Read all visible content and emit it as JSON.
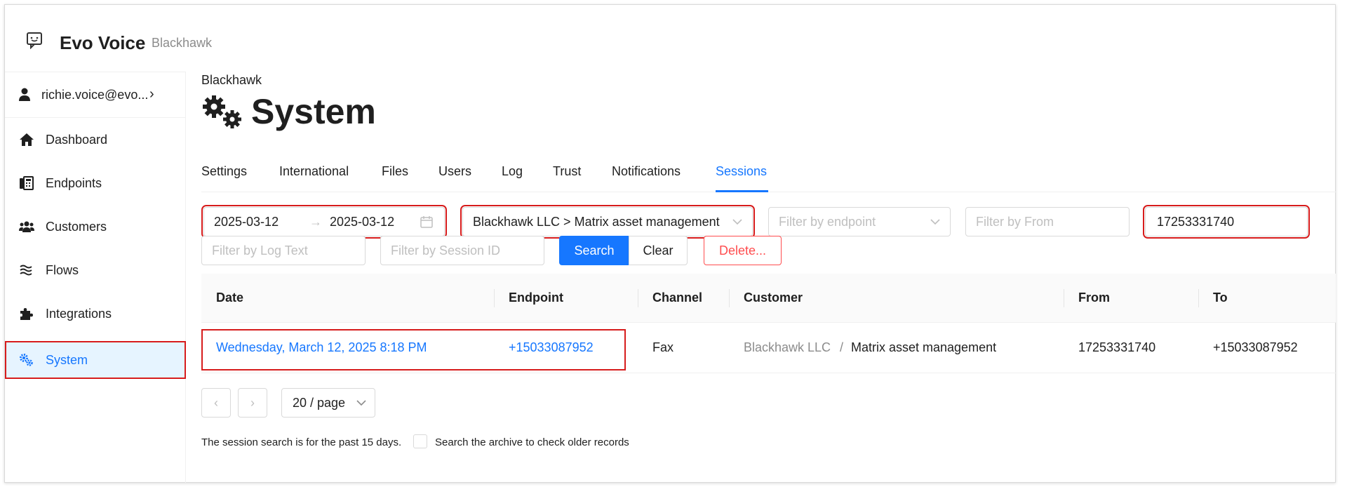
{
  "app": {
    "title": "Evo Voice",
    "subtitle": "Blackhawk",
    "logo_icon": "chat-bubble-icon"
  },
  "sidebar": {
    "user": {
      "label": "richie.voice@evo...",
      "icon": "user-icon",
      "chevron": "›"
    },
    "items": [
      {
        "label": "Dashboard",
        "icon": "home-icon"
      },
      {
        "label": "Endpoints",
        "icon": "phone-endpoints-icon"
      },
      {
        "label": "Customers",
        "icon": "users-icon"
      },
      {
        "label": "Flows",
        "icon": "flows-icon"
      },
      {
        "label": "Integrations",
        "icon": "puzzle-icon"
      },
      {
        "label": "System",
        "icon": "gears-icon",
        "active": true
      }
    ]
  },
  "page": {
    "breadcrumb": "Blackhawk",
    "title": "System",
    "title_icon": "gears-icon"
  },
  "tabs": [
    {
      "label": "Settings"
    },
    {
      "label": "International"
    },
    {
      "label": "Files"
    },
    {
      "label": "Users"
    },
    {
      "label": "Log"
    },
    {
      "label": "Trust"
    },
    {
      "label": "Notifications"
    },
    {
      "label": "Sessions",
      "active": true
    }
  ],
  "filters": {
    "date_start": "2025-03-12",
    "date_arrow": "→",
    "date_end": "2025-03-12",
    "customer_value": "Blackhawk LLC > Matrix asset management",
    "endpoint_placeholder": "Filter by endpoint",
    "from_placeholder": "Filter by From",
    "to_value": "17253331740",
    "log_text_placeholder": "Filter by Log Text",
    "session_id_placeholder": "Filter by Session ID",
    "search_label": "Search",
    "clear_label": "Clear",
    "delete_label": "Delete..."
  },
  "table": {
    "headers": [
      "Date",
      "Endpoint",
      "Channel",
      "Customer",
      "From",
      "To"
    ],
    "rows": [
      {
        "date": "Wednesday, March 12, 2025 8:18 PM",
        "endpoint": "+15033087952",
        "channel": "Fax",
        "customer_parent": "Blackhawk LLC",
        "customer_sep": "/",
        "customer_child": "Matrix asset management",
        "from": "17253331740",
        "to": "+15033087952"
      }
    ]
  },
  "pagination": {
    "prev": "‹",
    "next": "›",
    "page_size": "20 / page"
  },
  "footer": {
    "note": "The session search is for the past 15 days.",
    "archive_label": "Search the archive to check older records"
  },
  "colors": {
    "accent": "#1677ff",
    "highlight": "#d71c1c",
    "danger": "#ff4d4f"
  }
}
